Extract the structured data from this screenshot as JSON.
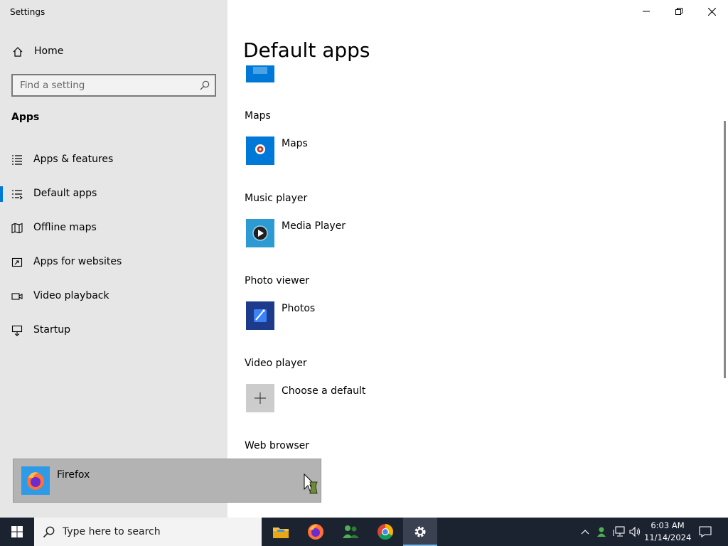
{
  "window": {
    "title": "Settings"
  },
  "sidebar": {
    "home_label": "Home",
    "search_placeholder": "Find a setting",
    "section": "Apps",
    "items": [
      {
        "label": "Apps & features",
        "icon": "list-icon"
      },
      {
        "label": "Default apps",
        "icon": "default-apps-icon",
        "active": true
      },
      {
        "label": "Offline maps",
        "icon": "map-icon"
      },
      {
        "label": "Apps for websites",
        "icon": "open-external-icon"
      },
      {
        "label": "Video playback",
        "icon": "video-icon"
      },
      {
        "label": "Startup",
        "icon": "startup-icon"
      }
    ]
  },
  "main": {
    "title": "Default apps",
    "categories": [
      {
        "label": "Maps",
        "app": "Maps",
        "icon": "maps-app-icon"
      },
      {
        "label": "Music player",
        "app": "Media Player",
        "icon": "media-player-icon"
      },
      {
        "label": "Photo viewer",
        "app": "Photos",
        "icon": "photos-icon"
      },
      {
        "label": "Video player",
        "app": "Choose a default",
        "icon": "plus-icon"
      },
      {
        "label": "Web browser",
        "app": "Firefox",
        "icon": "firefox-icon"
      }
    ]
  },
  "taskbar": {
    "search_placeholder": "Type here to search",
    "apps": [
      "file-explorer-icon",
      "firefox-icon",
      "people-icon",
      "chrome-icon",
      "settings-icon"
    ],
    "time": "6:03 AM",
    "date": "11/14/2024"
  },
  "colors": {
    "accent": "#0078d7",
    "sidebar_bg": "#e6e6e6",
    "taskbar_bg": "#1b2230"
  }
}
